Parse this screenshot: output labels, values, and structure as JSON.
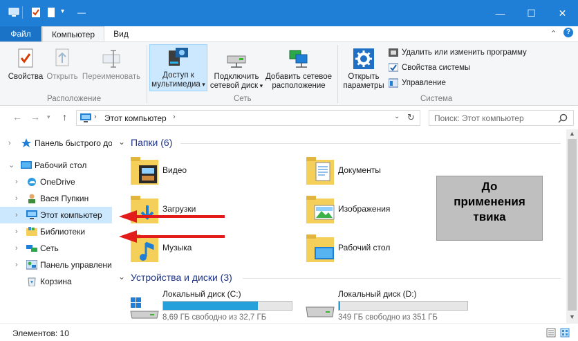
{
  "window": {
    "title": "—",
    "min_glyph": "—",
    "max_glyph": "☐",
    "close_glyph": "✕"
  },
  "tabs": {
    "file": "Файл",
    "computer": "Компьютер",
    "view": "Вид"
  },
  "ribbon": {
    "location_group": {
      "label": "Расположение",
      "properties": "Свойства",
      "open": "Открыть",
      "rename": "Переименовать"
    },
    "network_group": {
      "label": "Сеть",
      "media_access_line1": "Доступ к",
      "media_access_line2": "мультимедиа",
      "map_drive_line1": "Подключить",
      "map_drive_line2": "сетевой диск",
      "add_location_line1": "Добавить сетевое",
      "add_location_line2": "расположение"
    },
    "system_group": {
      "label": "Система",
      "open_settings_line1": "Открыть",
      "open_settings_line2": "параметры",
      "uninstall": "Удалить или изменить программу",
      "system_props": "Свойства системы",
      "manage": "Управление"
    }
  },
  "address": {
    "path": "Этот компьютер",
    "search_placeholder": "Поиск: Этот компьютер"
  },
  "nav_pane": {
    "items": [
      {
        "label": "Панель быстрого дос"
      },
      {
        "label": "Рабочий стол"
      },
      {
        "label": "OneDrive"
      },
      {
        "label": "Вася Пупкин"
      },
      {
        "label": "Этот компьютер"
      },
      {
        "label": "Библиотеки"
      },
      {
        "label": "Сеть"
      },
      {
        "label": "Панель управлени"
      },
      {
        "label": "Корзина"
      }
    ]
  },
  "folders_section": {
    "title": "Папки (6)",
    "items": [
      {
        "label": "Видео"
      },
      {
        "label": "Документы"
      },
      {
        "label": "Загрузки"
      },
      {
        "label": "Изображения"
      },
      {
        "label": "Музыка"
      },
      {
        "label": "Рабочий стол"
      }
    ]
  },
  "devices_section": {
    "title": "Устройства и диски (3)",
    "disks": [
      {
        "name": "Локальный диск (C:)",
        "free": "8,69 ГБ свободно из 32,7 ГБ",
        "used_fraction": 0.734
      },
      {
        "name": "Локальный диск (D:)",
        "free": "349 ГБ свободно из 351 ГБ",
        "used_fraction": 0.006
      }
    ]
  },
  "annotation": {
    "line1": "До",
    "line2": "применения",
    "line3": "твика"
  },
  "status": {
    "items_count": "Элементов: 10"
  },
  "colors": {
    "titlebar": "#1f7fd6",
    "accent": "#26a0da",
    "arrow": "#e31b1b",
    "selected": "#cce8ff"
  }
}
